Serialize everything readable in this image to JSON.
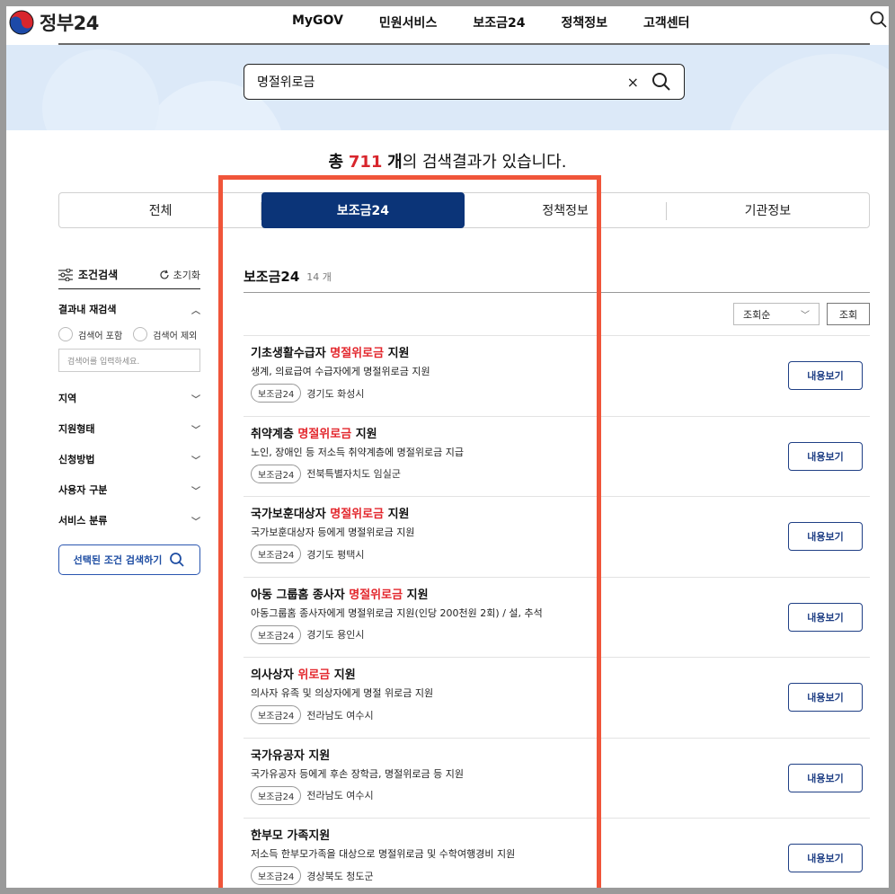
{
  "header": {
    "logo_text": "정부24",
    "nav": [
      "MyGOV",
      "민원서비스",
      "보조금24",
      "정책정보",
      "고객센터"
    ]
  },
  "search": {
    "query": "명절위로금",
    "clear_symbol": "×"
  },
  "result_summary": {
    "prefix": "총",
    "count": "711",
    "unit": "개",
    "suffix": "의 검색결과가 있습니다."
  },
  "tabs": [
    {
      "label": "전체",
      "active": false
    },
    {
      "label": "보조금24",
      "active": true
    },
    {
      "label": "정책정보",
      "active": false
    },
    {
      "label": "기관정보",
      "active": false
    }
  ],
  "sidebar": {
    "title": "조건검색",
    "reset": "초기화",
    "research_title": "결과내 재검색",
    "include_label": "검색어 포함",
    "exclude_label": "검색어 제외",
    "input_placeholder": "검색어를 입력하세요.",
    "filters": [
      "지역",
      "지원형태",
      "신청방법",
      "사용자 구분",
      "서비스 분류"
    ],
    "search_button": "선택된 조건 검색하기"
  },
  "main": {
    "title": "보조금24",
    "count": "14 개",
    "sort_value": "조회순",
    "sort_button": "조회",
    "view_label": "내용보기",
    "items": [
      {
        "pre": "기초생활수급자 ",
        "hl": "명절위로금",
        "post": " 지원",
        "desc": "생계, 의료급여 수급자에게 명절위로금 지원",
        "badge": "보조금24",
        "region": "경기도 화성시"
      },
      {
        "pre": "취약계층 ",
        "hl": "명절위로금",
        "post": " 지원",
        "desc": "노인, 장애인 등 저소득 취약계층에 명절위로금 지급",
        "badge": "보조금24",
        "region": "전북특별자치도 임실군"
      },
      {
        "pre": "국가보훈대상자 ",
        "hl": "명절위로금",
        "post": " 지원",
        "desc": "국가보훈대상자 등에게 명절위로금 지원",
        "badge": "보조금24",
        "region": "경기도 평택시"
      },
      {
        "pre": "아동 그룹홈 종사자 ",
        "hl": "명절위로금",
        "post": " 지원",
        "desc": "아동그룹홈 종사자에게 명절위로금 지원(인당 200천원 2회) / 설, 추석",
        "badge": "보조금24",
        "region": "경기도 용인시"
      },
      {
        "pre": "의사상자 ",
        "hl": "위로금",
        "post": " 지원",
        "desc": "의사자 유족 및 의상자에게 명절 위로금 지원",
        "badge": "보조금24",
        "region": "전라남도 여수시"
      },
      {
        "pre": "국가유공자 지원",
        "hl": "",
        "post": "",
        "desc": "국가유공자 등에게 후손 장학금, 명절위로금 등 지원",
        "badge": "보조금24",
        "region": "전라남도 여수시"
      },
      {
        "pre": "한부모 가족지원",
        "hl": "",
        "post": "",
        "desc": "저소득 한부모가족을 대상으로 명절위로금 및 수학여행경비 지원",
        "badge": "보조금24",
        "region": "경상북도 청도군"
      }
    ]
  },
  "colors": {
    "accent_navy": "#0b3478",
    "highlight_red": "#e3262c",
    "annotation_box": "#f0553a"
  }
}
